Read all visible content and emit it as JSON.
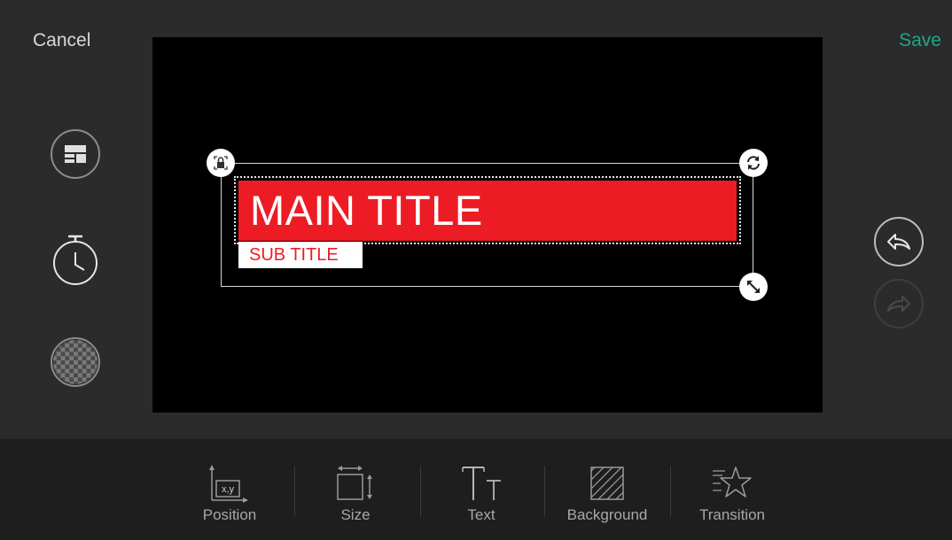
{
  "header": {
    "cancel_label": "Cancel",
    "save_label": "Save"
  },
  "left_tools": [
    {
      "icon": "layout-template-icon"
    },
    {
      "icon": "timer-icon"
    },
    {
      "icon": "transparency-checker-icon"
    }
  ],
  "right_tools": [
    {
      "icon": "undo-icon",
      "enabled": true
    },
    {
      "icon": "redo-icon",
      "enabled": false
    }
  ],
  "title_element": {
    "main_title": "MAIN TITLE",
    "sub_title": "SUB TITLE",
    "main_bg": "#ed1c24",
    "sub_text_color": "#ed1c24"
  },
  "handles": [
    "lock-icon",
    "rotate-icon",
    "resize-icon"
  ],
  "toolbar": {
    "items": [
      {
        "label": "Position",
        "icon": "position-icon",
        "icon_text": "x,y"
      },
      {
        "label": "Size",
        "icon": "size-icon"
      },
      {
        "label": "Text",
        "icon": "text-icon"
      },
      {
        "label": "Background",
        "icon": "background-icon"
      },
      {
        "label": "Transition",
        "icon": "transition-icon"
      }
    ]
  },
  "colors": {
    "accent": "#1fa784",
    "canvas": "#000000",
    "panel": "#2b2b2b",
    "toolbar": "#1e1e1e"
  }
}
